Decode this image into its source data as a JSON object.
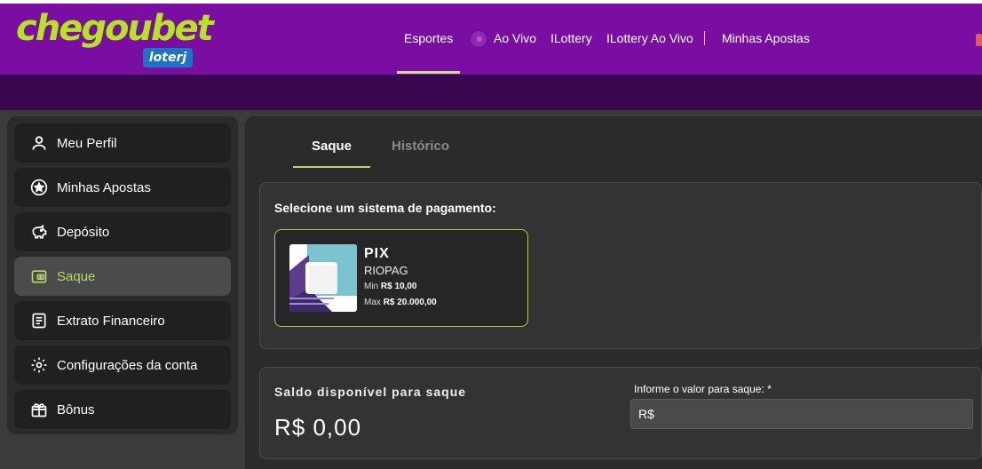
{
  "header": {
    "logo_main": "chegoubet",
    "logo_sub": "loterj",
    "nav": {
      "esportes": "Esportes",
      "ao_vivo": "Ao Vivo",
      "ilottery": "ILottery",
      "ilottery_ao_vivo": "ILottery Ao Vivo",
      "minhas_apostas": "Minhas Apostas"
    },
    "active_nav": "Esportes"
  },
  "sidebar": {
    "items": [
      {
        "label": "Meu Perfil",
        "icon": "user-icon"
      },
      {
        "label": "Minhas Apostas",
        "icon": "star-icon"
      },
      {
        "label": "Depósito",
        "icon": "piggy-bank-icon"
      },
      {
        "label": "Saque",
        "icon": "wallet-icon",
        "active": true
      },
      {
        "label": "Extrato Financeiro",
        "icon": "statement-icon"
      },
      {
        "label": "Configurações da conta",
        "icon": "gear-icon"
      },
      {
        "label": "Bônus",
        "icon": "gift-icon"
      }
    ]
  },
  "tabs": {
    "saque": "Saque",
    "historico": "Histórico",
    "active": "Saque"
  },
  "payment": {
    "title": "Selecione um sistema de pagamento:",
    "method": {
      "name": "PIX",
      "provider": "RIOPAG",
      "min_label": "Min",
      "min_value": "R$ 10,00",
      "max_label": "Max",
      "max_value": "R$ 20.000,00"
    }
  },
  "balance": {
    "label": "Saldo disponível para saque",
    "value": "R$ 0,00",
    "amount_label": "Informe o valor para saque: *",
    "amount_placeholder": "R$"
  },
  "colors": {
    "header": "#7a0ea3",
    "subbar": "#3a0850",
    "accent": "#b5d96a",
    "logo": "#b5e61d"
  }
}
